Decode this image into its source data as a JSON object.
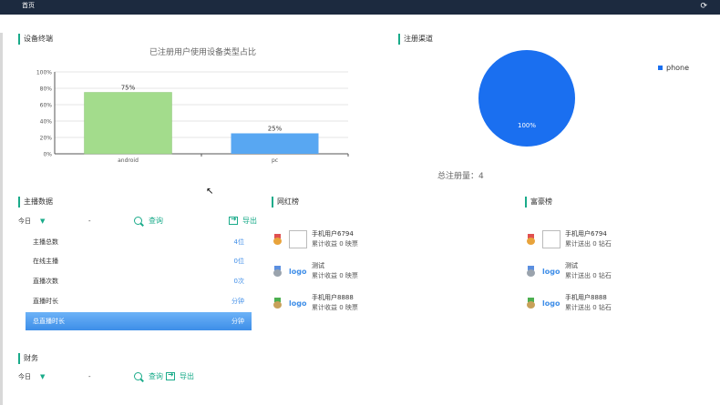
{
  "topbar": {
    "tab_label": "首页",
    "refresh_icon": "refresh-icon"
  },
  "device_section": {
    "title": "设备终端",
    "chart_title": "已注册用户使用设备类型占比"
  },
  "chart_data": [
    {
      "type": "bar",
      "title": "已注册用户使用设备类型占比",
      "categories": [
        "android",
        "pc"
      ],
      "values": [
        75,
        25
      ],
      "value_labels": [
        "75%",
        "25%"
      ],
      "colors": [
        "#a3dc8c",
        "#58a7f2"
      ],
      "ylim": [
        0,
        100
      ],
      "yticks": [
        "0%",
        "20%",
        "40%",
        "60%",
        "80%",
        "100%"
      ],
      "grid": true
    },
    {
      "type": "pie",
      "series": [
        {
          "name": "phone",
          "values": [
            100
          ]
        }
      ],
      "slice_labels": [
        "100%"
      ],
      "colors": [
        "#1a6ff0"
      ],
      "legend": "top-right"
    }
  ],
  "register_section": {
    "title": "注册渠道",
    "legend_label": "phone",
    "total_label": "总注册量：4"
  },
  "anchor_section": {
    "title": "主播数据",
    "filter_value": "今日",
    "range_dash": "-",
    "query_label": "查询",
    "export_label": "导出",
    "stats": [
      {
        "label": "主播总数",
        "value": "4位"
      },
      {
        "label": "在线主播",
        "value": "0位"
      },
      {
        "label": "直播次数",
        "value": "0次"
      },
      {
        "label": "直播时长",
        "value": "分钟"
      },
      {
        "label": "总直播时长",
        "value": "分钟"
      }
    ]
  },
  "influencer_section": {
    "title": "网红榜",
    "items": [
      {
        "name": "手机用户6794",
        "sub": "累计收益 0 映票",
        "thumb": "box"
      },
      {
        "name": "测试",
        "sub": "累计收益 0 映票",
        "thumb": "logo"
      },
      {
        "name": "手机用户8888",
        "sub": "累计收益 0 映票",
        "thumb": "logo"
      }
    ]
  },
  "rich_section": {
    "title": "富豪榜",
    "items": [
      {
        "name": "手机用户6794",
        "sub": "累计送出 0 钻石",
        "thumb": "box"
      },
      {
        "name": "测试",
        "sub": "累计送出 0 钻石",
        "thumb": "logo"
      },
      {
        "name": "手机用户8888",
        "sub": "累计送出 0 钻石",
        "thumb": "logo"
      }
    ]
  },
  "logo_text": "logo",
  "finance_section": {
    "title": "财务",
    "filter_value": "今日",
    "range_dash": "-",
    "query_label": "查询",
    "export_label": "导出"
  },
  "colors": {
    "accent": "#1aab8a",
    "link": "#3f8ee8",
    "topbar": "#1c2a3f"
  }
}
